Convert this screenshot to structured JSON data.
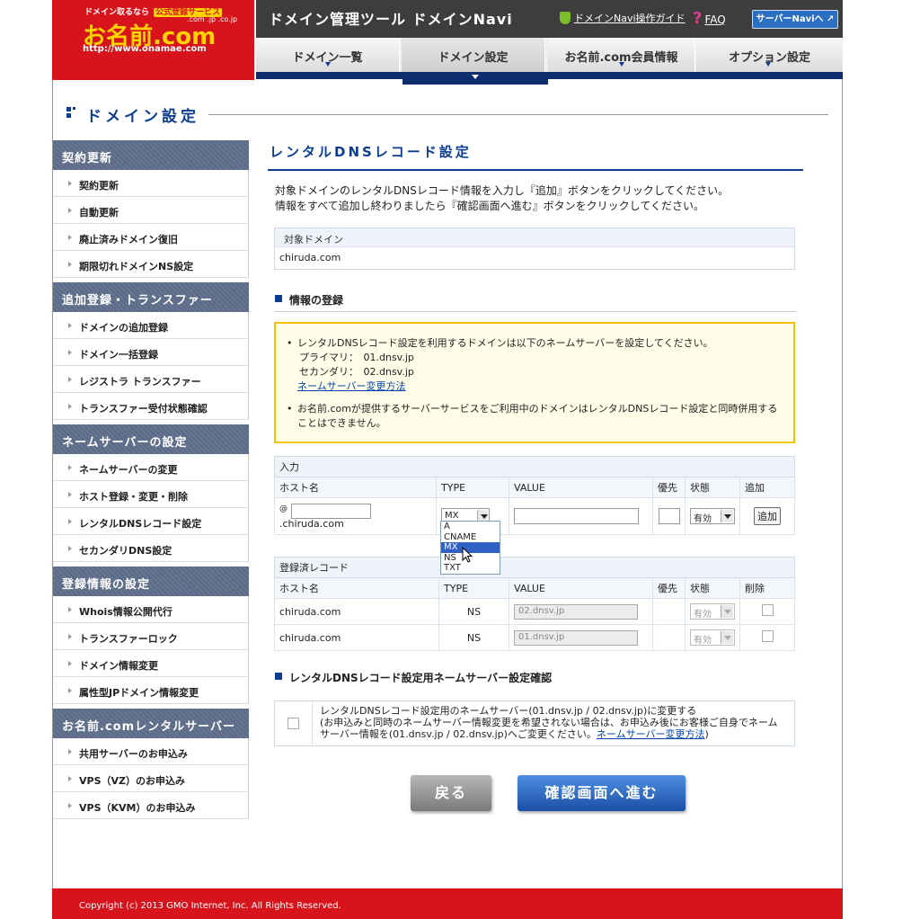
{
  "logo": {
    "tagline": "ドメイン取るなら",
    "badge": "公式登録サービス",
    "tlds": ".com .jp .co.jp",
    "name": "お名前.com",
    "url": "http://www.onamae.com"
  },
  "header": {
    "title": "ドメイン管理ツール ドメインNavi",
    "guide_link": "ドメインNavi操作ガイド",
    "faq_link": "FAQ",
    "server_button": "サーバーNaviへ ↗"
  },
  "nav": {
    "tabs": [
      {
        "label": "ドメイン一覧"
      },
      {
        "label": "ドメイン設定"
      },
      {
        "label": "お名前.com会員情報"
      },
      {
        "label": "オプション設定"
      }
    ]
  },
  "page_heading": "ドメイン設定",
  "sidebar": [
    {
      "heading": "契約更新",
      "items": [
        "契約更新",
        "自動更新",
        "廃止済みドメイン復旧",
        "期限切れドメインNS設定"
      ]
    },
    {
      "heading": "追加登録・トランスファー",
      "items": [
        "ドメインの追加登録",
        "ドメイン一括登録",
        "レジストラ トランスファー",
        "トランスファー受付状態確認"
      ]
    },
    {
      "heading": "ネームサーバーの設定",
      "items": [
        "ネームサーバーの変更",
        "ホスト登録・変更・削除",
        "レンタルDNSレコード設定",
        "セカンダリDNS設定"
      ]
    },
    {
      "heading": "登録情報の設定",
      "items": [
        "Whois情報公開代行",
        "トランスファーロック",
        "ドメイン情報変更",
        "属性型JPドメイン情報変更"
      ]
    },
    {
      "heading": "お名前.comレンタルサーバー",
      "items": [
        "共用サーバーのお申込み",
        "VPS（VZ）のお申込み",
        "VPS（KVM）のお申込み"
      ]
    }
  ],
  "main": {
    "title": "レンタルDNSレコード設定",
    "intro1": "対象ドメインのレンタルDNSレコード情報を入力し『追加』ボタンをクリックしてください。",
    "intro2": "情報をすべて追加し終わりましたら『確認画面へ進む』ボタンをクリックしてください。",
    "target_label": "対象ドメイン",
    "target_value": "chiruda.com",
    "section_register": "情報の登録",
    "notice": {
      "line1": "レンタルDNSレコード設定を利用するドメインは以下のネームサーバーを設定してください。",
      "primary": "プライマリ：　01.dnsv.jp",
      "secondary": "セカンダリ：　02.dnsv.jp",
      "link": "ネームサーバー変更方法",
      "line2": "お名前.comが提供するサーバーサービスをご利用中のドメインはレンタルDNSレコード設定と同時併用することはできません。"
    },
    "input": {
      "caption": "入力",
      "headers": [
        "ホスト名",
        "TYPE",
        "VALUE",
        "優先",
        "状態",
        "追加"
      ],
      "host_prefix": "@",
      "host_suffix": ".chiruda.com",
      "type_selected": "MX",
      "type_options": [
        "A",
        "CNAME",
        "MX",
        "NS",
        "TXT"
      ],
      "status_selected": "有効",
      "add_button": "追加"
    },
    "records": {
      "caption": "登録済レコード",
      "headers": [
        "ホスト名",
        "TYPE",
        "VALUE",
        "優先",
        "状態",
        "削除"
      ],
      "rows": [
        {
          "host": "chiruda.com",
          "type": "NS",
          "value": "02.dnsv.jp",
          "status": "有効"
        },
        {
          "host": "chiruda.com",
          "type": "NS",
          "value": "01.dnsv.jp",
          "status": "有効"
        }
      ]
    },
    "section_confirm": "レンタルDNSレコード設定用ネームサーバー設定確認",
    "confirm": {
      "line1": "レンタルDNSレコード設定用のネームサーバー(01.dnsv.jp / 02.dnsv.jp)に変更する",
      "line2": "(お申込みと同時のネームサーバー情報変更を希望されない場合は、お申込み後にお客様ご自身でネームサーバー情報を(01.dnsv.jp / 02.dnsv.jp)へご変更ください。",
      "link": "ネームサーバー変更方法",
      "close": ")"
    },
    "back_button": "戻る",
    "next_button": "確認画面へ進む"
  },
  "footer": "Copyright (c) 2013 GMO Internet, Inc. All Rights Reserved."
}
